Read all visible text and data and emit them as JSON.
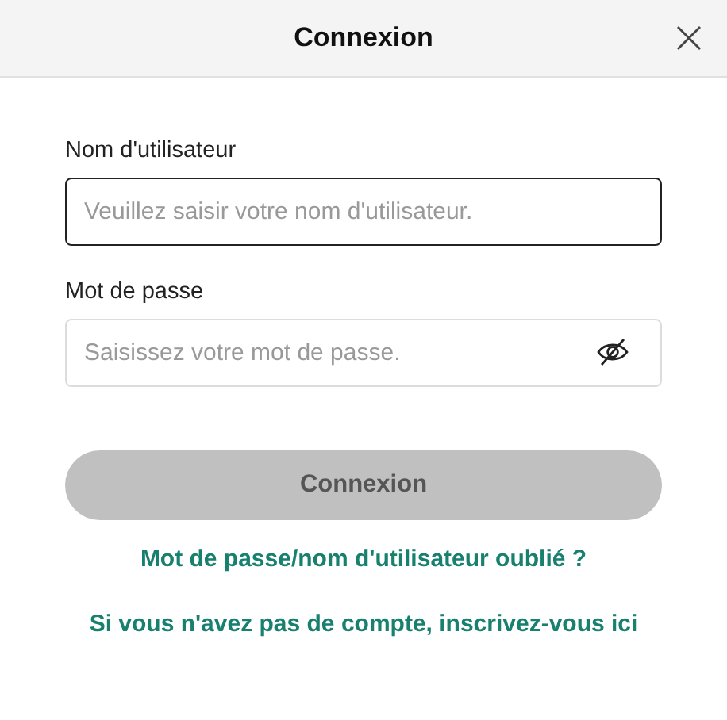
{
  "window": {
    "title": "Connexion"
  },
  "fields": [
    {
      "label": "Nom d'utilisateur",
      "placeholder": "Veuillez saisir votre nom d'utilisateur.",
      "kind": "text",
      "focused": true
    },
    {
      "label": "Mot de passe",
      "placeholder": "Saisissez votre mot de passe.",
      "kind": "password",
      "focused": false,
      "password_visible": false
    }
  ],
  "submit": {
    "label": "Connexion",
    "disabled": true
  },
  "links": [
    "Mot de passe/nom d'utilisateur oublié ?",
    "Si vous n'avez pas de compte, inscrivez-vous ici"
  ]
}
